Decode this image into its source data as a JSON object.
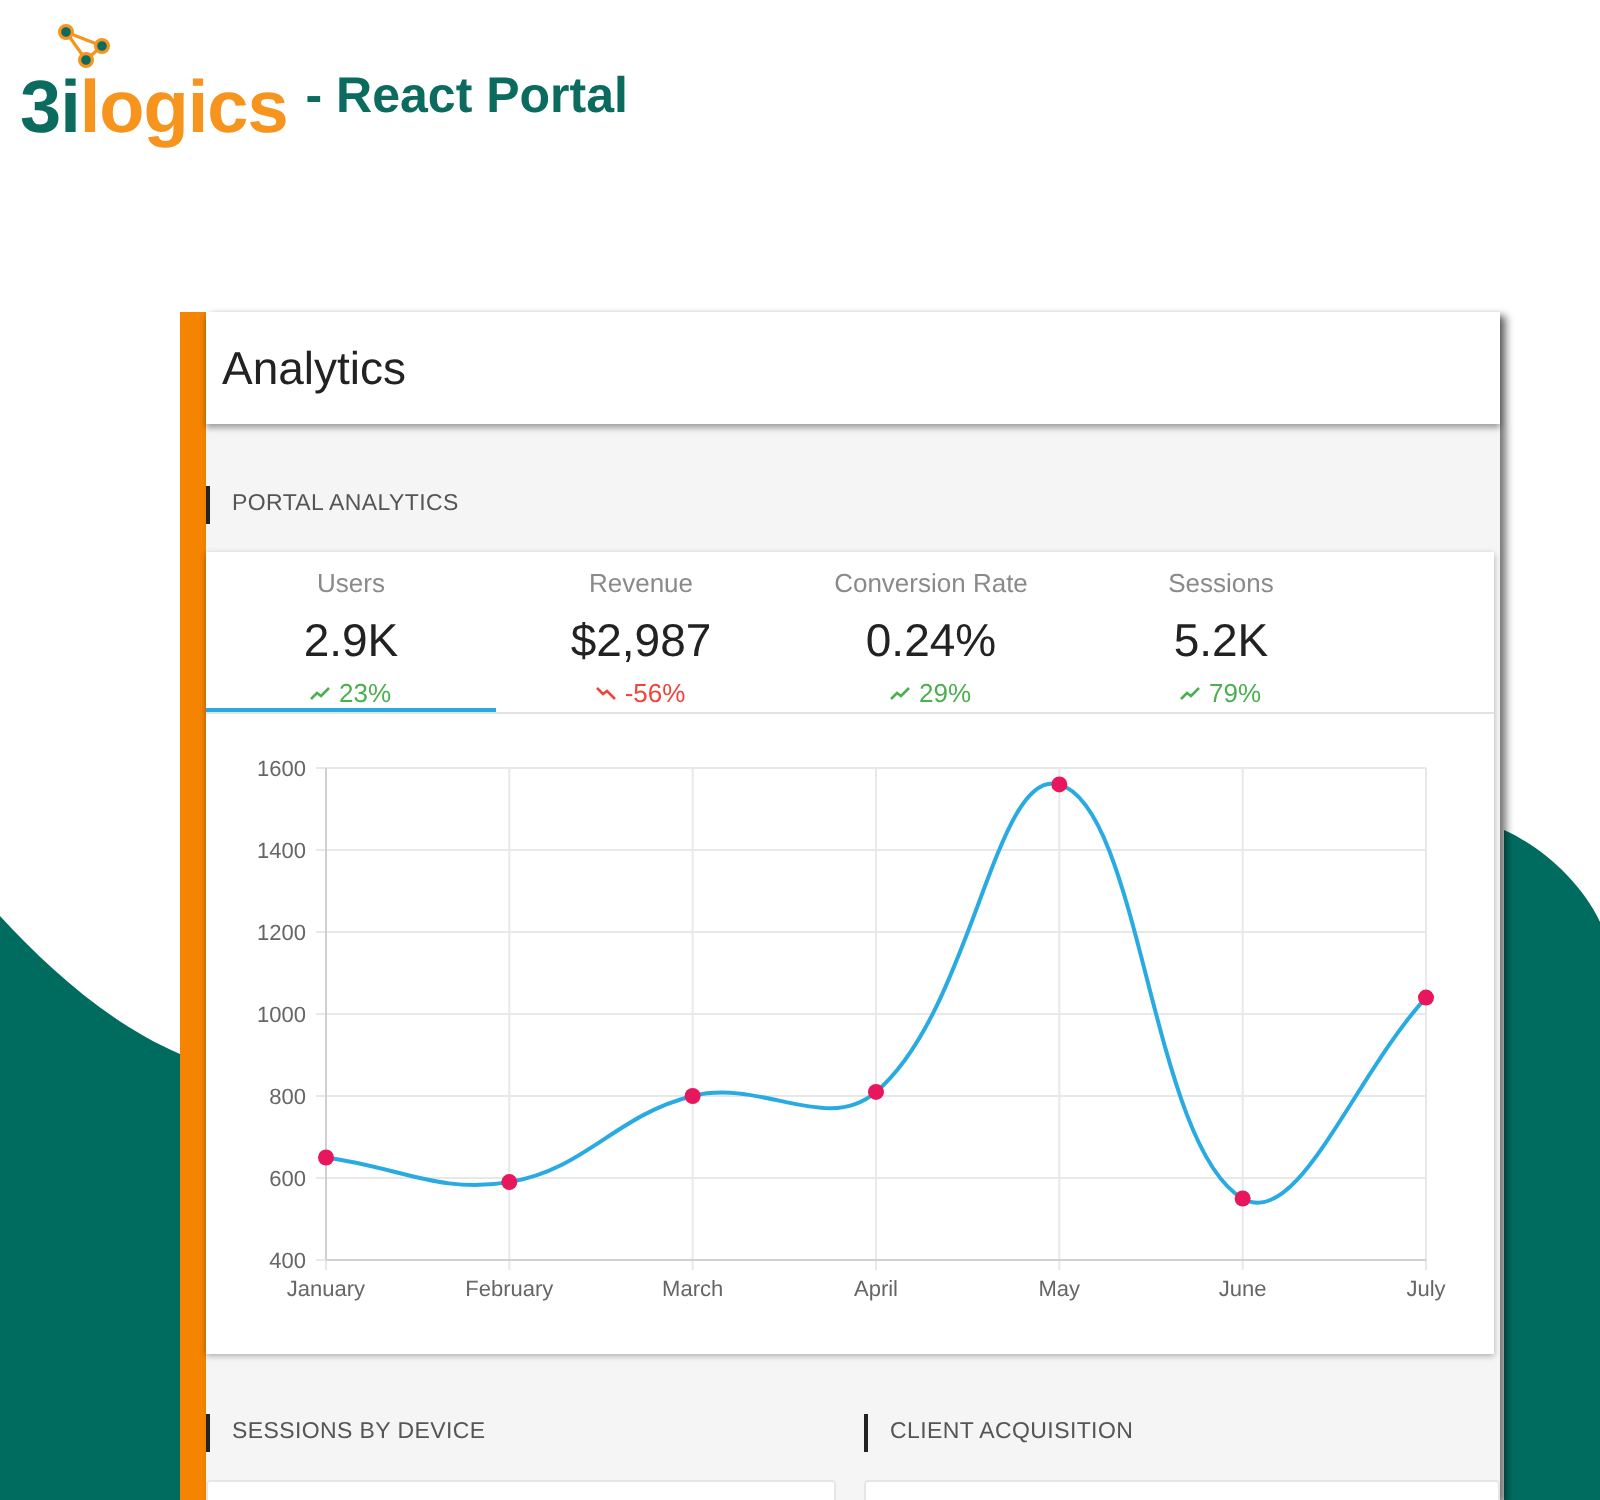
{
  "logo": {
    "text_parts": [
      {
        "text": "3i",
        "color": "#0b6b5e"
      },
      {
        "text": "logics",
        "color": "#f7941d"
      }
    ],
    "tagline": "- React Portal"
  },
  "app_bar": {
    "title": "Analytics"
  },
  "portal_analytics": {
    "heading": "PORTAL ANALYTICS",
    "tabs": [
      {
        "label": "Users",
        "value": "2.9K",
        "change": "23%",
        "kind": "up",
        "selected": true
      },
      {
        "label": "Revenue",
        "value": "$2,987",
        "change": "-56%",
        "kind": "down",
        "selected": false
      },
      {
        "label": "Conversion Rate",
        "value": "0.24%",
        "change": "29%",
        "kind": "up",
        "selected": false
      },
      {
        "label": "Sessions",
        "value": "5.2K",
        "change": "79%",
        "kind": "up",
        "selected": false
      }
    ],
    "chart_data": {
      "type": "line",
      "categories": [
        "January",
        "February",
        "March",
        "April",
        "May",
        "June",
        "July"
      ],
      "series": [
        {
          "color": "#29abe2",
          "marker": true,
          "values": [
            650,
            590,
            800,
            810,
            1560,
            550,
            1040
          ]
        }
      ],
      "ylim": [
        400,
        1600
      ],
      "yticks": [
        400,
        600,
        800,
        1000,
        1200,
        1400,
        1600
      ],
      "grid": true
    }
  },
  "sections": [
    {
      "heading": "SESSIONS BY DEVICE"
    },
    {
      "heading": "CLIENT ACQUISITION"
    }
  ]
}
